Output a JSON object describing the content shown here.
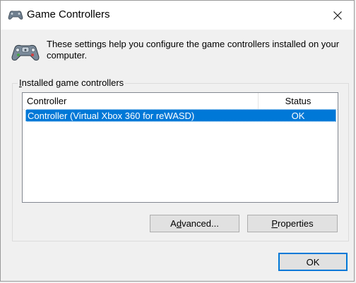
{
  "window": {
    "title": "Game Controllers",
    "close_icon": "close-x-icon",
    "app_icon": "gamepad-icon"
  },
  "description": "These settings help you configure the game controllers installed on your computer.",
  "group": {
    "label_accel": "I",
    "label_rest": "nstalled game controllers"
  },
  "list": {
    "columns": {
      "controller": "Controller",
      "status": "Status"
    },
    "rows": [
      {
        "name": "Controller (Virtual Xbox 360 for reWASD)",
        "status": "OK",
        "selected": true
      }
    ]
  },
  "buttons": {
    "advanced_pre": "A",
    "advanced_accel": "d",
    "advanced_post": "vanced...",
    "properties_accel": "P",
    "properties_post": "roperties",
    "ok": "OK"
  },
  "colors": {
    "selection": "#0078d7",
    "window_bg": "#f0f0f0",
    "titlebar_bg": "#ffffff"
  }
}
